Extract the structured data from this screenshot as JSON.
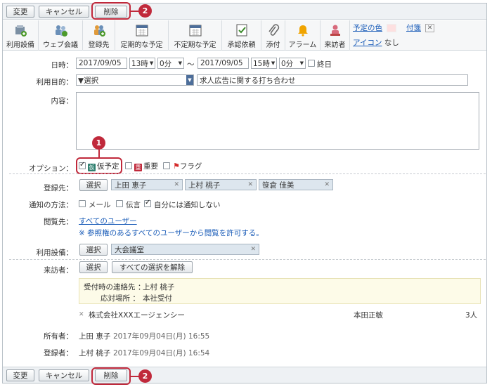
{
  "top_buttons": {
    "change": "変更",
    "cancel": "キャンセル",
    "delete": "削除"
  },
  "callouts": {
    "first": "1",
    "second": "2"
  },
  "toolbar": {
    "items": [
      "利用設備",
      "ウェブ会議",
      "登録先",
      "定期的な予定",
      "不定期な予定",
      "承認依頼",
      "添付",
      "アラーム",
      "来訪者"
    ],
    "schedule_color": "予定の色",
    "attachment": "付箋",
    "icon_label": "アイコン",
    "icon_value": "なし"
  },
  "datetime": {
    "label": "日時：",
    "start_date": "2017/09/05",
    "start_hour": "13時",
    "start_min": "0分",
    "sep": "〜",
    "end_date": "2017/09/05",
    "end_hour": "15時",
    "end_min": "0分",
    "allday": "終日"
  },
  "purpose": {
    "label": "利用目的：",
    "select": "▼選択",
    "value": "求人広告に関する打ち合わせ"
  },
  "content": {
    "label": "内容："
  },
  "options": {
    "label": "オプション：",
    "tentative": "仮予定",
    "important": "重要",
    "flag": "フラグ",
    "tentative_tag": "仮",
    "important_tag": "重"
  },
  "registrants": {
    "label": "登録先：",
    "select": "選択",
    "chips": [
      "上田 恵子",
      "上村 桃子",
      "笹倉 佳美"
    ]
  },
  "notify": {
    "label": "通知の方法：",
    "mail": "メール",
    "memo": "伝言",
    "self": "自分には通知しない"
  },
  "viewers": {
    "label": "閲覧先：",
    "link": "すべてのユーザー",
    "note": "※ 参照権のあるすべてのユーザーから閲覧を許可する。"
  },
  "equipment": {
    "label": "利用設備：",
    "select": "選択",
    "chip": "大会議室"
  },
  "visitors": {
    "label": "来訪者：",
    "select": "選択",
    "clear": "すべての選択を解除",
    "contact_label": "受付時の連絡先 ：",
    "contact_value": "上村 桃子",
    "place_label": "応対場所 ：",
    "place_value": "本社受付",
    "company": "株式会社XXXエージェンシー",
    "person": "本田正敏",
    "count": "3人"
  },
  "owner": {
    "label": "所有者：",
    "name": "上田 恵子",
    "date": "2017年09月04日(月) 16:55"
  },
  "registrar": {
    "label": "登録者：",
    "name": "上村 桃子",
    "date": "2017年09月04日(月) 16:54"
  },
  "colors": {
    "accent": "#c0293b",
    "link": "#1a5cb8",
    "panel": "#fdfbe8"
  }
}
